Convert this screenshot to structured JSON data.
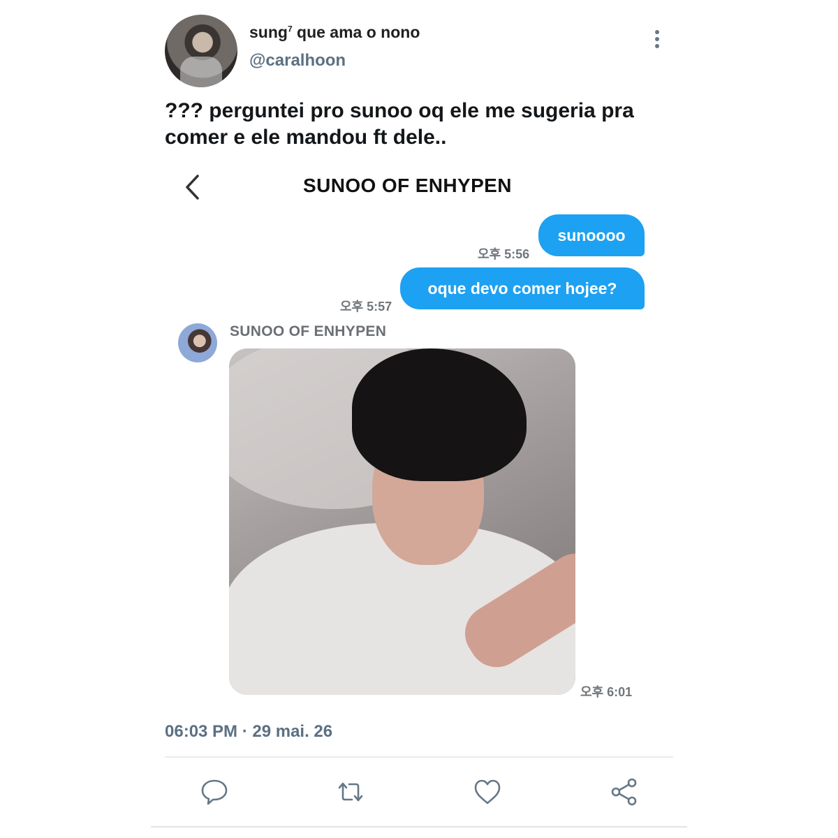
{
  "tweet": {
    "display_name": "sung",
    "display_name_sup": "7",
    "display_name_rest": " que ama o nono",
    "handle": "@caralhoon",
    "text": "??? perguntei pro sunoo oq ele me sugeria pra comer e ele mandou ft dele..",
    "timestamp": "06:03 PM · 29 mai. 26"
  },
  "chat": {
    "title": "SUNOO OF ENHYPEN",
    "messages": [
      {
        "text": "sunoooo",
        "time": "오후 5:56"
      },
      {
        "text": "oque devo comer hojee?",
        "time": "오후 5:57"
      }
    ],
    "sender_name": "SUNOO OF ENHYPEN",
    "photo_time": "오후 6:01"
  },
  "icons": {
    "more": "more-vertical-icon",
    "back": "chevron-left-icon",
    "reply": "reply-icon",
    "retweet": "retweet-icon",
    "like": "heart-icon",
    "share": "share-icon"
  },
  "colors": {
    "bubble": "#1da1f2",
    "secondary_text": "#5b7083",
    "icon": "#657786"
  }
}
